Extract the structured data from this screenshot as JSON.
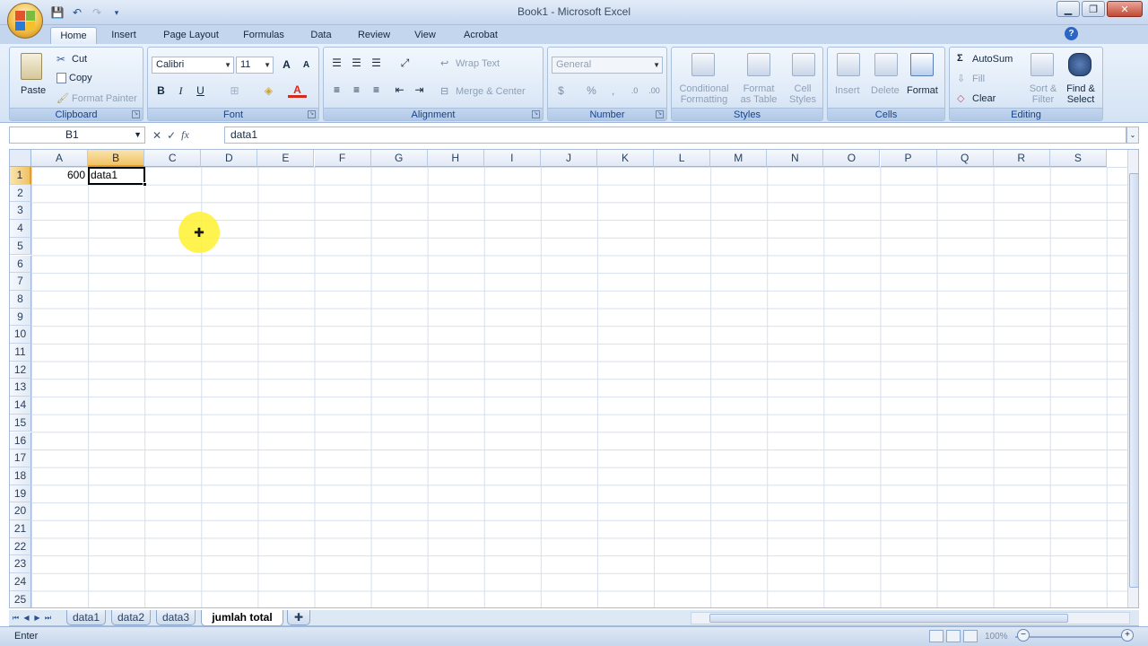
{
  "window": {
    "title": "Book1 - Microsoft Excel",
    "minimize": "▁",
    "maximize": "❐",
    "close": "✕"
  },
  "qat": {
    "save": "💾",
    "undo": "↶",
    "redo": "↷",
    "customize": "▾"
  },
  "tabs": [
    "Home",
    "Insert",
    "Page Layout",
    "Formulas",
    "Data",
    "Review",
    "View",
    "Acrobat"
  ],
  "help": "?",
  "ribbon": {
    "clipboard": {
      "label": "Clipboard",
      "paste": "Paste",
      "cut": "Cut",
      "copy": "Copy",
      "format_painter": "Format Painter"
    },
    "font": {
      "label": "Font",
      "name": "Calibri",
      "size": "11",
      "grow": "A",
      "shrink": "A",
      "bold": "B",
      "italic": "I",
      "underline": "U",
      "font_color_letter": "A"
    },
    "alignment": {
      "label": "Alignment",
      "wrap_text": "Wrap Text",
      "merge_center": "Merge & Center"
    },
    "number": {
      "label": "Number",
      "format": "General",
      "currency": "$",
      "percent": "%",
      "comma": ",",
      "inc_decimal": ".0",
      "dec_decimal": ".00"
    },
    "styles": {
      "label": "Styles",
      "conditional": "Conditional",
      "conditional2": "Formatting",
      "format_table": "Format",
      "format_table2": "as Table",
      "cell_styles": "Cell",
      "cell_styles2": "Styles"
    },
    "cells": {
      "label": "Cells",
      "insert": "Insert",
      "delete": "Delete",
      "format": "Format"
    },
    "editing": {
      "label": "Editing",
      "autosum": "AutoSum",
      "fill": "Fill",
      "clear": "Clear",
      "sort": "Sort &",
      "sort2": "Filter",
      "find": "Find &",
      "find2": "Select"
    }
  },
  "formula_bar": {
    "name_box": "B1",
    "content": "data1",
    "fx": "fx",
    "cancel": "✕",
    "enter": "✓"
  },
  "columns": [
    "A",
    "B",
    "C",
    "D",
    "E",
    "F",
    "G",
    "H",
    "I",
    "J",
    "K",
    "L",
    "M",
    "N",
    "O",
    "P",
    "Q",
    "R",
    "S"
  ],
  "rows": [
    "1",
    "2",
    "3",
    "4",
    "5",
    "6",
    "7",
    "8",
    "9",
    "10",
    "11",
    "12",
    "13",
    "14",
    "15",
    "16",
    "17",
    "18",
    "19",
    "20",
    "21",
    "22",
    "23",
    "24",
    "25"
  ],
  "cells": {
    "A1": "600",
    "B1": "data1"
  },
  "selected": {
    "column": "B",
    "row": "1"
  },
  "sheets": {
    "tabs": [
      "data1",
      "data2",
      "data3",
      "jumlah total"
    ],
    "active": "jumlah total"
  },
  "status": {
    "mode": "Enter",
    "zoom": "100%"
  },
  "colors": {
    "selection_header": "#f1c264",
    "accent": "#15428b",
    "cursor_highlight": "#fff23d"
  }
}
